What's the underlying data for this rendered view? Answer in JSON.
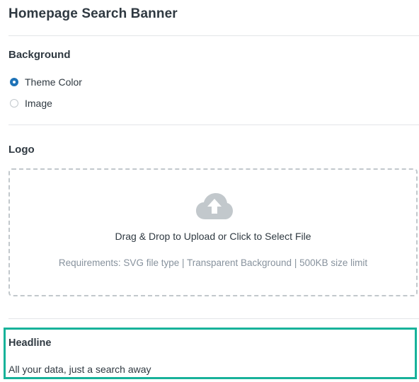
{
  "page": {
    "title": "Homepage Search Banner"
  },
  "background": {
    "label": "Background",
    "options": [
      {
        "label": "Theme Color",
        "selected": true
      },
      {
        "label": "Image",
        "selected": false
      }
    ]
  },
  "logo": {
    "label": "Logo",
    "icon": "cloud-upload-icon",
    "upload_text": "Drag & Drop to Upload or Click to Select File",
    "requirements": "Requirements: SVG file type | Transparent Background | 500KB size limit"
  },
  "headline": {
    "label": "Headline",
    "value": "All your data, just a search away"
  },
  "colors": {
    "accent": "#1f73b7",
    "highlight_border": "#17b29a",
    "text": "#2f3941",
    "muted_text": "#87929d",
    "icon": "#c2c8cc"
  }
}
